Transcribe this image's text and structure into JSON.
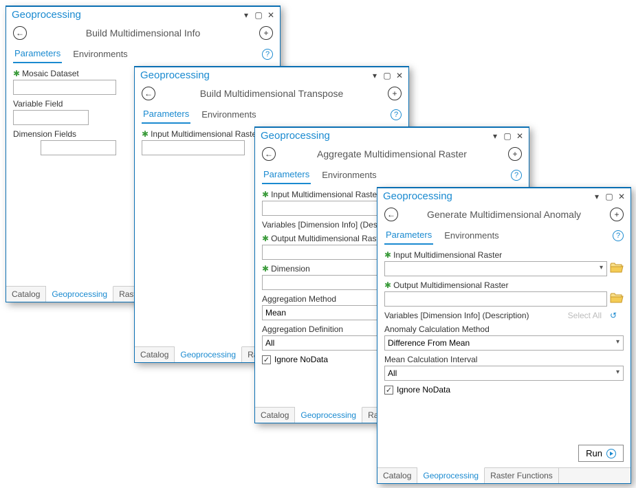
{
  "app_title": "Geoprocessing",
  "tabs": {
    "parameters": "Parameters",
    "environments": "Environments"
  },
  "bottom_tabs": {
    "catalog": "Catalog",
    "geoprocessing": "Geoprocessing",
    "raster": "Raster",
    "raster_functions": "Raster Functions"
  },
  "common": {
    "select_all": "Select All",
    "run": "Run"
  },
  "panel1": {
    "title": "Build Multidimensional Info",
    "fields": {
      "mosaic": "Mosaic Dataset",
      "variable": "Variable Field",
      "dimension": "Dimension Fields"
    }
  },
  "panel2": {
    "title": "Build Multidimensional Transpose",
    "fields": {
      "input": "Input Multidimensional Raster"
    }
  },
  "panel3": {
    "title": "Aggregate Multidimensional Raster",
    "fields": {
      "input": "Input Multidimensional Raster",
      "variables": "Variables [Dimension Info] (Description)",
      "output": "Output Multidimensional Raster",
      "dimension": "Dimension",
      "agg_method": "Aggregation Method",
      "agg_method_val": "Mean",
      "agg_def": "Aggregation Definition",
      "agg_def_val": "All",
      "ignore": "Ignore NoData"
    }
  },
  "panel4": {
    "title": "Generate Multidimensional Anomaly",
    "fields": {
      "input": "Input Multidimensional Raster",
      "output": "Output Multidimensional Raster",
      "variables": "Variables [Dimension Info] (Description)",
      "anom_method": "Anomaly Calculation Method",
      "anom_method_val": "Difference From Mean",
      "mean_interval": "Mean Calculation Interval",
      "mean_interval_val": "All",
      "ignore": "Ignore NoData"
    }
  }
}
